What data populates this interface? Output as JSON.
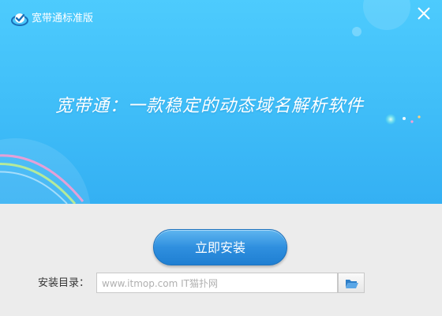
{
  "window": {
    "title": "宽带通标准版"
  },
  "banner": {
    "tagline": "宽带通：一款稳定的动态域名解析软件"
  },
  "install": {
    "button_label": "立即安装"
  },
  "directory": {
    "label": "安装目录：",
    "value": "www.itmop.com IT猫扑网",
    "placeholder": ""
  },
  "icons": {
    "logo": "app-logo-icon",
    "close": "close-icon",
    "browse": "folder-open-icon"
  },
  "colors": {
    "banner": "#3fbdf8",
    "button": "#2f8fdf",
    "background": "#ececec"
  }
}
